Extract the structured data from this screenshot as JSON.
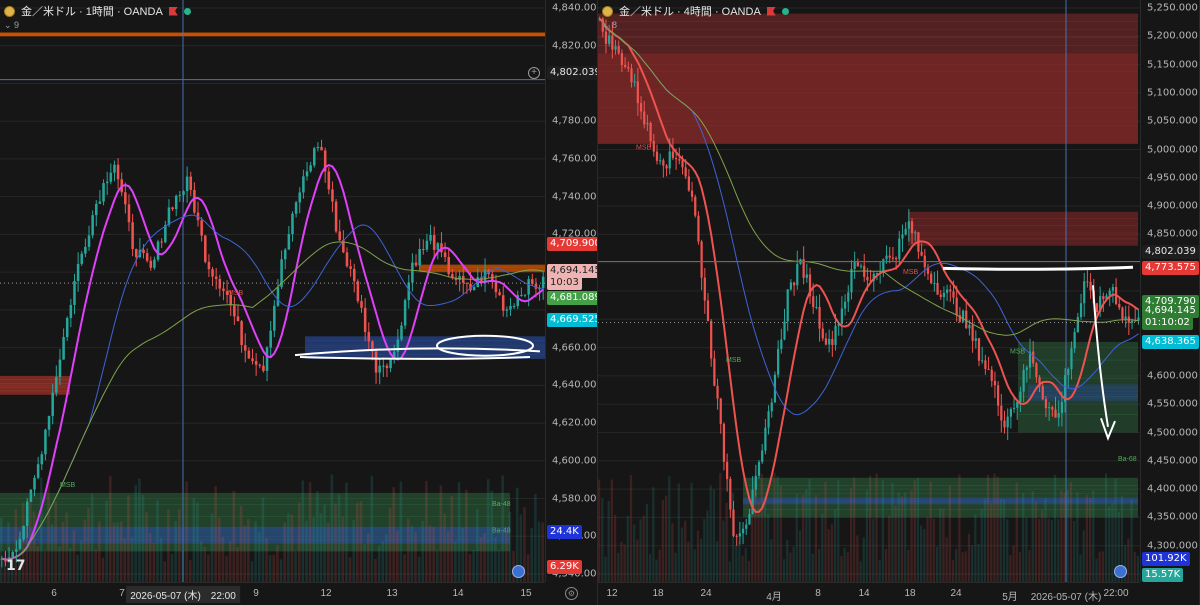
{
  "left": {
    "title": "金／米ドル · 1時間 · OANDA",
    "indicator_count": "9",
    "price_ticks": [
      "4,840.000",
      "4,820.000",
      "4,802.039",
      "4,780.000",
      "4,760.000",
      "4,740.000",
      "4,720.000",
      "4,709.900",
      "4,700.000",
      "4,694.145",
      "10:03",
      "4,681.089",
      "4,669.525",
      "4,660.000",
      "4,640.000",
      "4,620.000",
      "4,600.000",
      "4,580.000",
      "4,560.000",
      "24.4K",
      "4,540.000",
      "6.29K"
    ],
    "x_ticks": [
      "6",
      "7",
      "9",
      "12",
      "13",
      "14",
      "15"
    ],
    "cursor_time": "2026-05-07 (木)　22:00",
    "labels": {
      "crosshair": "4,802.039",
      "red_level": "4,709.900",
      "last_price": "4,694.145",
      "countdown": "10:03",
      "green_level": "4,681.089",
      "cyan_level": "4,669.525",
      "volume_blue": "24.4K",
      "volume_red": "6.29K"
    },
    "zone_labels": [
      "MSB",
      "MSB",
      "Ba-48",
      "Ba-48"
    ]
  },
  "right": {
    "title": "金／米ドル · 4時間 · OANDA",
    "indicator_count": "8",
    "price_ticks": [
      "5,250.000",
      "5,200.000",
      "5,150.000",
      "5,100.000",
      "5,050.000",
      "5,000.000",
      "4,950.000",
      "4,900.000",
      "4,850.000",
      "4,800.000",
      "4,750.000",
      "4,700.000",
      "4,650.000",
      "4,600.000",
      "4,550.000",
      "4,500.000",
      "4,450.000",
      "4,400.000",
      "4,350.000",
      "4,300.000"
    ],
    "x_ticks": [
      "12",
      "18",
      "24",
      "4月",
      "8",
      "14",
      "18",
      "24",
      "5月",
      "2026-05-07 (木)",
      "22:00"
    ],
    "labels": {
      "crosshair": "4,802.039",
      "red_level": "4,773.575",
      "upper": "4,709.790",
      "last_price": "4,694.145",
      "countdown": "01:10:02",
      "cyan_level": "4,638.365",
      "volume_blue": "101.92K",
      "volume_green": "15.57K"
    },
    "zone_labels": [
      "MSB",
      "MSB",
      "MSB",
      "MSB",
      "Ba-68"
    ]
  },
  "colors": {
    "bull": "#26a69a",
    "bear": "#ef5350",
    "zone_red": "#8f2b2b",
    "zone_green": "#2e6b3f",
    "zone_blue": "#2a4b9a",
    "magenta": "#e040fb",
    "sma_green": "#7fa34a",
    "sma_blue": "#3d63d6"
  },
  "chart_data": [
    {
      "type": "candlestick",
      "title": "金／米ドル · 1時間 · OANDA",
      "ylim": [
        4540,
        4840
      ],
      "x_categories": [
        "6",
        "7",
        "9",
        "12",
        "13",
        "14",
        "15"
      ],
      "last_price": 4694.145,
      "levels": [
        4802.039,
        4709.9,
        4681.089,
        4669.525
      ],
      "approx_path": [
        4545,
        4560,
        4600,
        4650,
        4700,
        4735,
        4760,
        4715,
        4700,
        4735,
        4748,
        4705,
        4690,
        4660,
        4650,
        4705,
        4745,
        4770,
        4720,
        4690,
        4650,
        4655,
        4705,
        4718,
        4700,
        4690,
        4700,
        4680,
        4692,
        4694
      ]
    },
    {
      "type": "candlestick",
      "title": "金／米ドル · 4時間 · OANDA",
      "ylim": [
        4250,
        5250
      ],
      "x_categories": [
        "12",
        "18",
        "24",
        "4月",
        "8",
        "14",
        "18",
        "24",
        "5月"
      ],
      "last_price": 4694.145,
      "levels": [
        4802.039,
        4773.575,
        4709.79,
        4638.365
      ],
      "approx_path": [
        5220,
        5180,
        5150,
        5080,
        5000,
        4980,
        4990,
        4900,
        4700,
        4500,
        4320,
        4350,
        4450,
        4600,
        4750,
        4800,
        4720,
        4650,
        4720,
        4800,
        4770,
        4800,
        4820,
        4870,
        4800,
        4760,
        4740,
        4700,
        4650,
        4600,
        4520,
        4560,
        4640,
        4560,
        4520,
        4650,
        4760,
        4720,
        4760,
        4700,
        4694
      ]
    }
  ]
}
